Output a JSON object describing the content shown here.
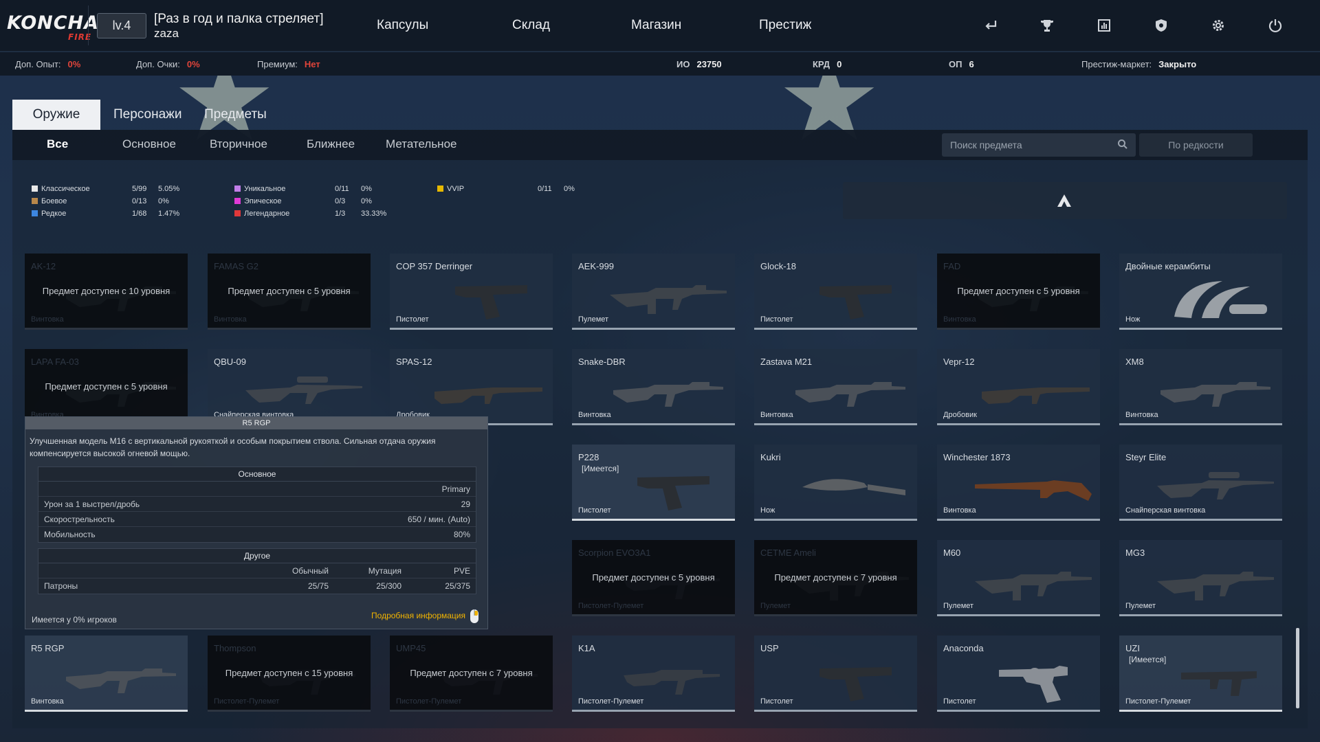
{
  "header": {
    "logo": "KONCHA",
    "logo_sub": "FIRE",
    "level": "lv.4",
    "clan": "[Раз в год и палка стреляет]",
    "nickname": "zaza",
    "nav": [
      "Капсулы",
      "Склад",
      "Магазин",
      "Престиж"
    ],
    "icons": [
      "exit-icon",
      "trophy-icon",
      "stats-icon",
      "shield-icon",
      "gear-icon",
      "power-icon"
    ]
  },
  "stats": {
    "exp_label": "Доп. Опыт:",
    "exp_value": "0%",
    "points_label": "Доп. Очки:",
    "points_value": "0%",
    "premium_label": "Премиум:",
    "premium_value": "Нет",
    "io_label": "ИО",
    "io_value": "23750",
    "krd_label": "КРД",
    "krd_value": "0",
    "op_label": "ОП",
    "op_value": "6",
    "market_label": "Престиж-маркет:",
    "market_value": "Закрыто"
  },
  "category_tabs": [
    "Оружие",
    "Персонажи",
    "Предметы"
  ],
  "sub_tabs": [
    "Все",
    "Основное",
    "Вторичное",
    "Ближнее",
    "Метательное"
  ],
  "search": {
    "placeholder": "Поиск предмета"
  },
  "sort_label": "По редкости",
  "rarity": [
    {
      "label": "Классическое",
      "count": "5/99",
      "pct": "5.05%",
      "color": "#e8e8e8"
    },
    {
      "label": "Боевое",
      "count": "0/13",
      "pct": "0%",
      "color": "#b8874a"
    },
    {
      "label": "Редкое",
      "count": "1/68",
      "pct": "1.47%",
      "color": "#3d86e0"
    },
    {
      "label": "Уникальное",
      "count": "0/11",
      "pct": "0%",
      "color": "#c17ee8"
    },
    {
      "label": "Эпическое",
      "count": "0/3",
      "pct": "0%",
      "color": "#e03ad6"
    },
    {
      "label": "Легендарное",
      "count": "1/3",
      "pct": "33.33%",
      "color": "#e0383a"
    },
    {
      "label": "VVIP",
      "count": "0/11",
      "pct": "0%",
      "color": "#e6b800"
    }
  ],
  "items": [
    {
      "name": "AK-12",
      "type": "Винтовка",
      "locked": true,
      "lock_msg": "Предмет доступен с 10 уровня",
      "shape": "rifle"
    },
    {
      "name": "FAMAS G2",
      "type": "Винтовка",
      "locked": true,
      "lock_msg": "Предмет доступен с 5 уровня",
      "shape": "rifle"
    },
    {
      "name": "COP 357 Derringer",
      "type": "Пистолет",
      "locked": false,
      "shape": "pistol"
    },
    {
      "name": "AEK-999",
      "type": "Пулемет",
      "locked": false,
      "shape": "mg"
    },
    {
      "name": "Glock-18",
      "type": "Пистолет",
      "locked": false,
      "shape": "pistol"
    },
    {
      "name": "FAD",
      "type": "Винтовка",
      "locked": true,
      "lock_msg": "Предмет доступен с 5 уровня",
      "shape": "rifle"
    },
    {
      "name": "Двойные керамбиты",
      "type": "Нож",
      "locked": false,
      "shape": "karambit"
    },
    {
      "name": "LAPA FA-03",
      "type": "Винтовка",
      "locked": true,
      "lock_msg": "Предмет доступен с 5 уровня",
      "shape": "rifle"
    },
    {
      "name": "QBU-09",
      "type": "Снайперская винтовка",
      "locked": false,
      "shape": "sniper"
    },
    {
      "name": "SPAS-12",
      "type": "Дробовик",
      "locked": false,
      "shape": "shotgun"
    },
    {
      "name": "Snake-DBR",
      "type": "Винтовка",
      "locked": false,
      "shape": "rifle"
    },
    {
      "name": "Zastava M21",
      "type": "Винтовка",
      "locked": false,
      "shape": "rifle"
    },
    {
      "name": "Vepr-12",
      "type": "Дробовик",
      "locked": false,
      "shape": "shotgun"
    },
    {
      "name": "XM8",
      "type": "Винтовка",
      "locked": false,
      "shape": "rifle"
    },
    {
      "name": "",
      "type": "",
      "locked": false,
      "shape": "rifle",
      "hidden": true
    },
    {
      "name": "",
      "type": "",
      "locked": false,
      "shape": "rifle",
      "hidden": true
    },
    {
      "name": "",
      "type": "",
      "locked": false,
      "shape": "rifle",
      "hidden": true
    },
    {
      "name": "P228",
      "owned_label": "[Имеется]",
      "type": "Пистолет",
      "locked": false,
      "owned": true,
      "shape": "pistol"
    },
    {
      "name": "Kukri",
      "type": "Нож",
      "locked": false,
      "shape": "knife"
    },
    {
      "name": "Winchester 1873",
      "type": "Винтовка",
      "locked": false,
      "shape": "lever"
    },
    {
      "name": "Steyr Elite",
      "type": "Снайперская винтовка",
      "locked": false,
      "shape": "sniper"
    },
    {
      "name": "",
      "type": "",
      "locked": false,
      "shape": "smg",
      "hidden": true
    },
    {
      "name": "",
      "type": "",
      "locked": false,
      "shape": "smg",
      "hidden": true
    },
    {
      "name": "",
      "type": "",
      "locked": false,
      "shape": "smg",
      "hidden": true
    },
    {
      "name": "Scorpion EVO3A1",
      "type": "Пистолет-Пулемет",
      "locked": true,
      "lock_msg": "Предмет доступен с 5 уровня",
      "shape": "smg"
    },
    {
      "name": "CETME Ameli",
      "type": "Пулемет",
      "locked": true,
      "lock_msg": "Предмет доступен с 7 уровня",
      "shape": "mg"
    },
    {
      "name": "M60",
      "type": "Пулемет",
      "locked": false,
      "shape": "mg"
    },
    {
      "name": "MG3",
      "type": "Пулемет",
      "locked": false,
      "shape": "mg"
    },
    {
      "name": "R5 RGP",
      "type": "Винтовка",
      "locked": false,
      "owned": true,
      "shape": "rifle"
    },
    {
      "name": "Thompson",
      "type": "Пистолет-Пулемет",
      "locked": true,
      "lock_msg": "Предмет доступен с 15 уровня",
      "shape": "smg"
    },
    {
      "name": "UMP45",
      "type": "Пистолет-Пулемет",
      "locked": true,
      "lock_msg": "Предмет доступен с 7 уровня",
      "shape": "smg"
    },
    {
      "name": "K1A",
      "type": "Пистолет-Пулемет",
      "locked": false,
      "shape": "smg"
    },
    {
      "name": "USP",
      "type": "Пистолет",
      "locked": false,
      "shape": "pistol"
    },
    {
      "name": "Anaconda",
      "type": "Пистолет",
      "locked": false,
      "shape": "revolver"
    },
    {
      "name": "UZI",
      "owned_label": "[Имеется]",
      "type": "Пистолет-Пулемет",
      "locked": false,
      "owned": true,
      "shape": "uzi"
    }
  ],
  "tooltip": {
    "title": "R5 RGP",
    "description": "Улучшенная модель M16 с вертикальной рукояткой и особым покрытием ствола. Сильная отдача оружия компенсируется высокой огневой мощью.",
    "main_header": "Основное",
    "main_col": "Primary",
    "main_rows": [
      {
        "label": "Урон за 1 выстрел/дробь",
        "value": "29"
      },
      {
        "label": "Скорострельность",
        "value": "650 / мин. (Auto)"
      },
      {
        "label": "Мобильность",
        "value": "80%"
      }
    ],
    "other_header": "Другое",
    "other_cols": [
      "Обычный",
      "Мутация",
      "PVE"
    ],
    "ammo_label": "Патроны",
    "ammo": [
      "25/75",
      "25/300",
      "25/375"
    ],
    "owned_by": "Имеется у 0% игроков",
    "more": "Подробная информация"
  }
}
